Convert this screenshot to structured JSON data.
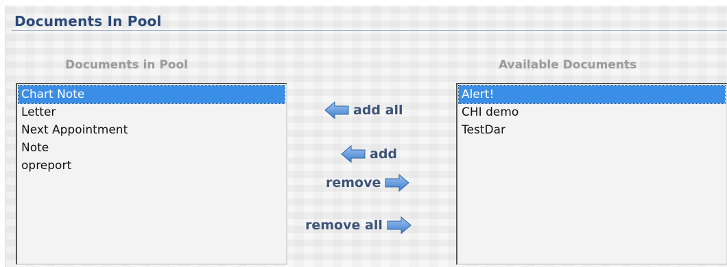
{
  "section": {
    "title": "Documents In Pool"
  },
  "pool": {
    "heading": "Documents in Pool",
    "items": [
      "Chart Note",
      "Letter",
      "Next Appointment",
      "Note",
      "opreport"
    ],
    "selected_index": 0
  },
  "available": {
    "heading": "Available Documents",
    "items": [
      "Alert!",
      "CHI demo",
      "TestDar"
    ],
    "selected_index": 0
  },
  "actions": {
    "add_all": "add all",
    "add": "add",
    "remove": "remove",
    "remove_all": "remove all"
  },
  "colors": {
    "title": "#2a4a78",
    "selection": "#3a8ee6",
    "arrow": "#5b93d6",
    "action_text": "#3d5478"
  }
}
